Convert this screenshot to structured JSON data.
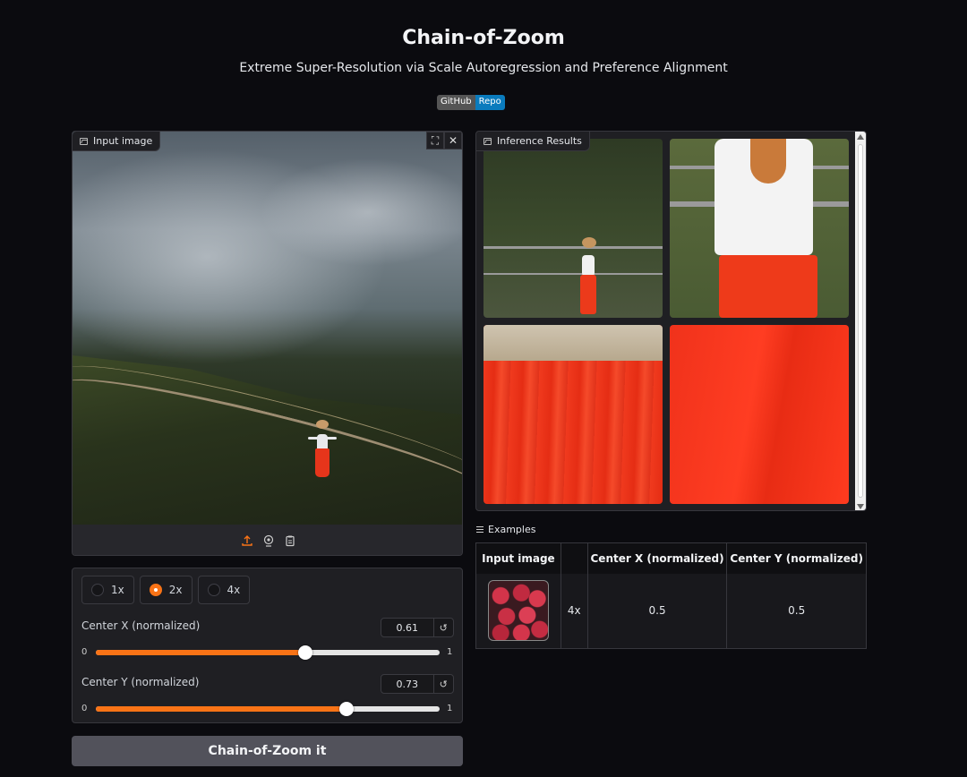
{
  "header": {
    "title": "Chain-of-Zoom",
    "subtitle": "Extreme Super-Resolution via Scale Autoregression and Preference Alignment",
    "badge_left": "GitHub",
    "badge_right": "Repo"
  },
  "input_panel": {
    "label": "Input image",
    "label_icon": "image-icon",
    "fullscreen_icon": "fullscreen-icon",
    "close_icon": "close-icon",
    "toolbar_icons": [
      "upload-icon",
      "webcam-icon",
      "clipboard-icon"
    ]
  },
  "results_panel": {
    "label": "Inference Results",
    "label_icon": "image-icon"
  },
  "scale_options": {
    "options": [
      "1x",
      "2x",
      "4x"
    ],
    "selected": "2x"
  },
  "sliders": {
    "center_x": {
      "label": "Center X (normalized)",
      "value": "0.61",
      "min": "0",
      "max": "1",
      "fraction": 0.61
    },
    "center_y": {
      "label": "Center Y (normalized)",
      "value": "0.73",
      "min": "0",
      "max": "1",
      "fraction": 0.73
    },
    "reset_icon": "reset-icon"
  },
  "run_button": {
    "label": "Chain-of-Zoom it"
  },
  "examples": {
    "label": "Examples",
    "label_icon": "list-icon",
    "headers": [
      "Input image",
      "",
      "Center X (normalized)",
      "Center Y (normalized)"
    ],
    "rows": [
      {
        "scale": "4x",
        "center_x": "0.5",
        "center_y": "0.5"
      }
    ]
  },
  "colors": {
    "accent": "#f97316",
    "background": "#0b0b0f",
    "panel": "#1f1f23",
    "button": "#52525b",
    "badge_blue": "#0a7bbd"
  }
}
